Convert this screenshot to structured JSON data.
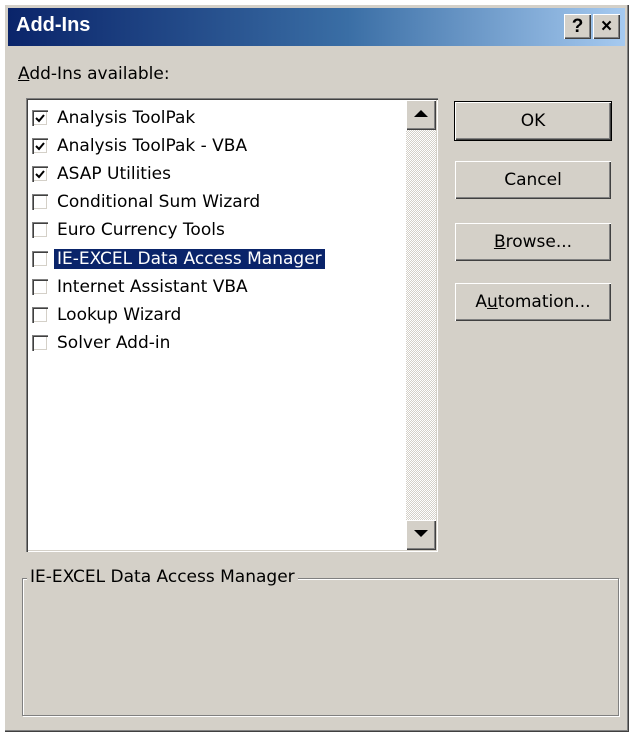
{
  "window": {
    "title": "Add-Ins",
    "help_glyph": "?",
    "close_glyph": "×",
    "help_icon": "question-icon",
    "close_icon": "close-icon"
  },
  "list": {
    "label_accel": "A",
    "label_rest": "dd-Ins available:",
    "items": [
      {
        "label": "Analysis ToolPak",
        "checked": true,
        "selected": false
      },
      {
        "label": "Analysis ToolPak - VBA",
        "checked": true,
        "selected": false
      },
      {
        "label": "ASAP Utilities",
        "checked": true,
        "selected": false
      },
      {
        "label": "Conditional Sum Wizard",
        "checked": false,
        "selected": false
      },
      {
        "label": "Euro Currency Tools",
        "checked": false,
        "selected": false
      },
      {
        "label": "IE-EXCEL Data Access Manager",
        "checked": false,
        "selected": true
      },
      {
        "label": "Internet Assistant VBA",
        "checked": false,
        "selected": false
      },
      {
        "label": "Lookup Wizard",
        "checked": false,
        "selected": false
      },
      {
        "label": "Solver Add-in",
        "checked": false,
        "selected": false
      }
    ]
  },
  "buttons": {
    "ok": "OK",
    "cancel": "Cancel",
    "browse_accel": "B",
    "browse_rest": "rowse...",
    "automation_pre": "A",
    "automation_accel": "u",
    "automation_rest": "tomation..."
  },
  "description": {
    "title": "IE-EXCEL Data Access Manager",
    "body": ""
  },
  "colors": {
    "dialog_bg": "#d4d0c8",
    "title_gradient_start": "#0a246a",
    "title_gradient_end": "#a6caf0",
    "selection": "#0a246a"
  }
}
